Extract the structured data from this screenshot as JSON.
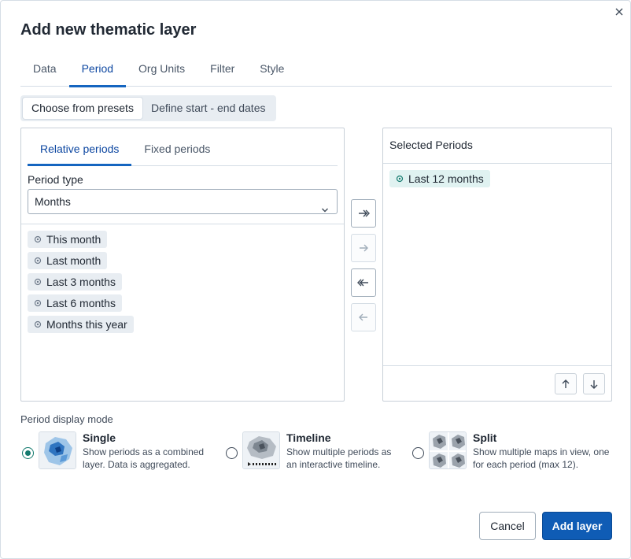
{
  "dialog": {
    "title": "Add new thematic layer",
    "tabs": [
      {
        "label": "Data"
      },
      {
        "label": "Period"
      },
      {
        "label": "Org Units"
      },
      {
        "label": "Filter"
      },
      {
        "label": "Style"
      }
    ],
    "active_tab": "Period"
  },
  "period_mode_toggle": {
    "options": [
      {
        "label": "Choose from presets"
      },
      {
        "label": "Define start - end dates"
      }
    ],
    "selected": "Choose from presets"
  },
  "available": {
    "subtabs": [
      {
        "label": "Relative periods"
      },
      {
        "label": "Fixed periods"
      }
    ],
    "active_subtab": "Relative periods",
    "period_type_label": "Period type",
    "period_type_value": "Months",
    "items": [
      {
        "label": "This month"
      },
      {
        "label": "Last month"
      },
      {
        "label": "Last 3 months"
      },
      {
        "label": "Last 6 months"
      },
      {
        "label": "Months this year"
      }
    ]
  },
  "selected_panel": {
    "header": "Selected Periods",
    "items": [
      {
        "label": "Last 12 months"
      }
    ]
  },
  "transfer_icons": [
    "select-all-icon",
    "select-icon",
    "deselect-all-icon",
    "deselect-icon"
  ],
  "display_mode": {
    "label": "Period display mode",
    "selected": "Single",
    "options": [
      {
        "title": "Single",
        "desc_line1": "Show periods as a combined",
        "desc_line2": "layer. Data is aggregated."
      },
      {
        "title": "Timeline",
        "desc_line1": "Show multiple periods as",
        "desc_line2": "an interactive timeline."
      },
      {
        "title": "Split",
        "desc_line1": "Show multiple maps in view, one",
        "desc_line2": "for each period (max 12)."
      }
    ]
  },
  "actions": {
    "cancel": "Cancel",
    "add": "Add layer"
  },
  "colors": {
    "primary": "#0f5cb5",
    "tab_accent": "#1565c0",
    "radio_checked": "#147a6e",
    "selected_chip": "#e0f2f1"
  }
}
